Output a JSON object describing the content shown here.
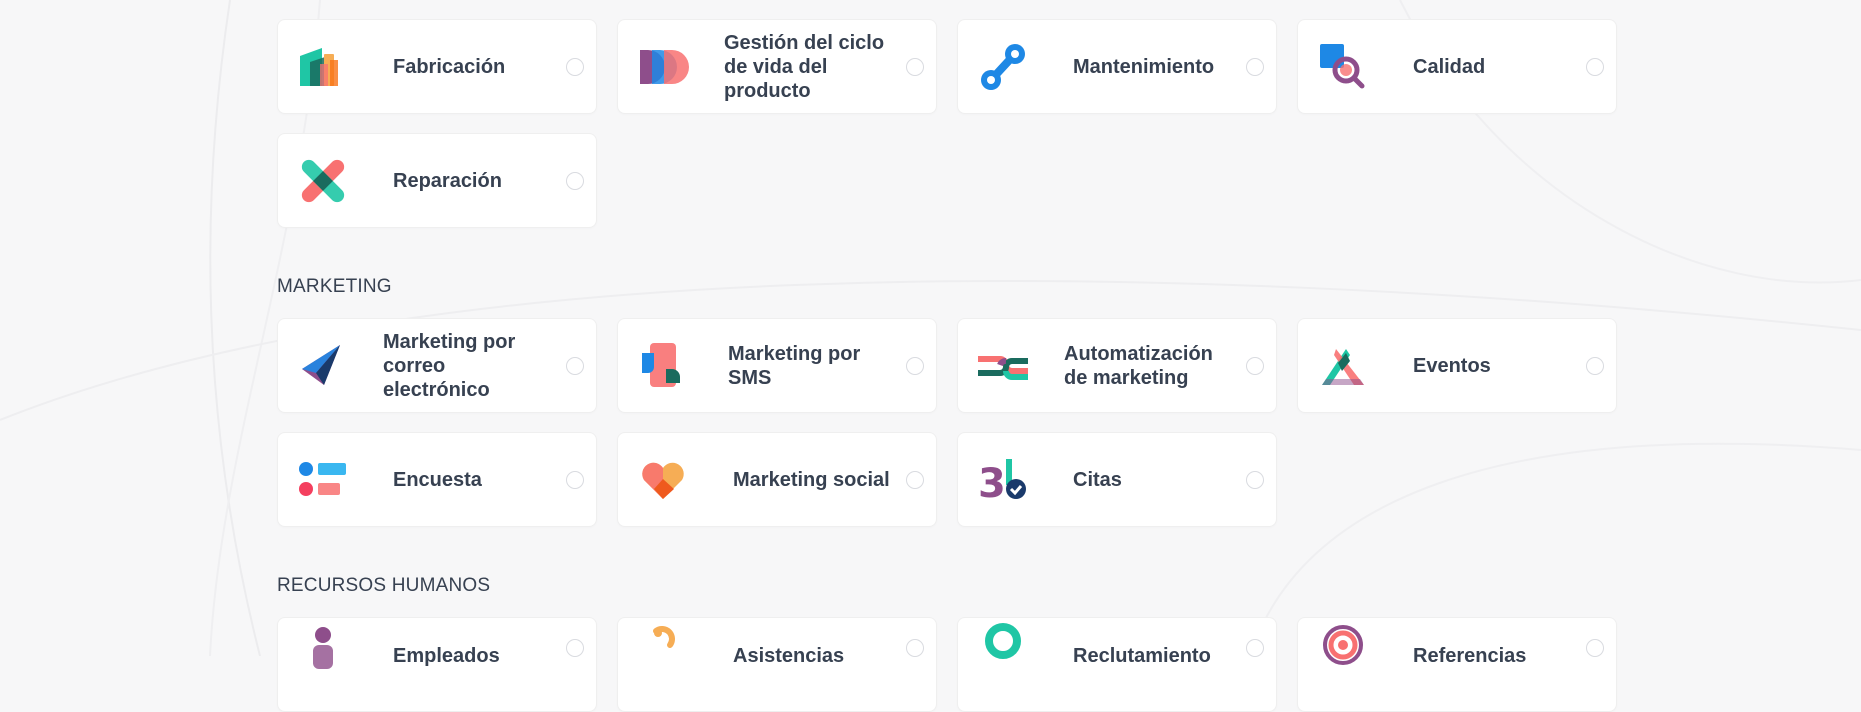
{
  "sections": [
    {
      "id": "inventario",
      "apps": [
        {
          "label": "Fabricación",
          "icon": "manufacturing-icon"
        },
        {
          "label": "Gestión del ciclo de vida del producto",
          "icon": "plm-icon"
        },
        {
          "label": "Mantenimiento",
          "icon": "maintenance-icon"
        },
        {
          "label": "Calidad",
          "icon": "quality-icon"
        },
        {
          "label": "Reparación",
          "icon": "repair-icon"
        }
      ]
    },
    {
      "id": "marketing",
      "title": "MARKETING",
      "apps": [
        {
          "label": "Marketing por correo electrónico",
          "icon": "email-marketing-icon"
        },
        {
          "label": "Marketing por SMS",
          "icon": "sms-marketing-icon"
        },
        {
          "label": "Automatización de marketing",
          "icon": "marketing-automation-icon"
        },
        {
          "label": "Eventos",
          "icon": "events-icon"
        },
        {
          "label": "Encuesta",
          "icon": "survey-icon"
        },
        {
          "label": "Marketing social",
          "icon": "social-marketing-icon"
        },
        {
          "label": "Citas",
          "icon": "appointments-icon"
        }
      ]
    },
    {
      "id": "rrhh",
      "title": "RECURSOS HUMANOS",
      "apps": [
        {
          "label": "Empleados",
          "icon": "employees-icon"
        },
        {
          "label": "Asistencias",
          "icon": "attendance-icon"
        },
        {
          "label": "Reclutamiento",
          "icon": "recruitment-icon"
        },
        {
          "label": "Referencias",
          "icon": "referrals-icon"
        }
      ]
    }
  ]
}
